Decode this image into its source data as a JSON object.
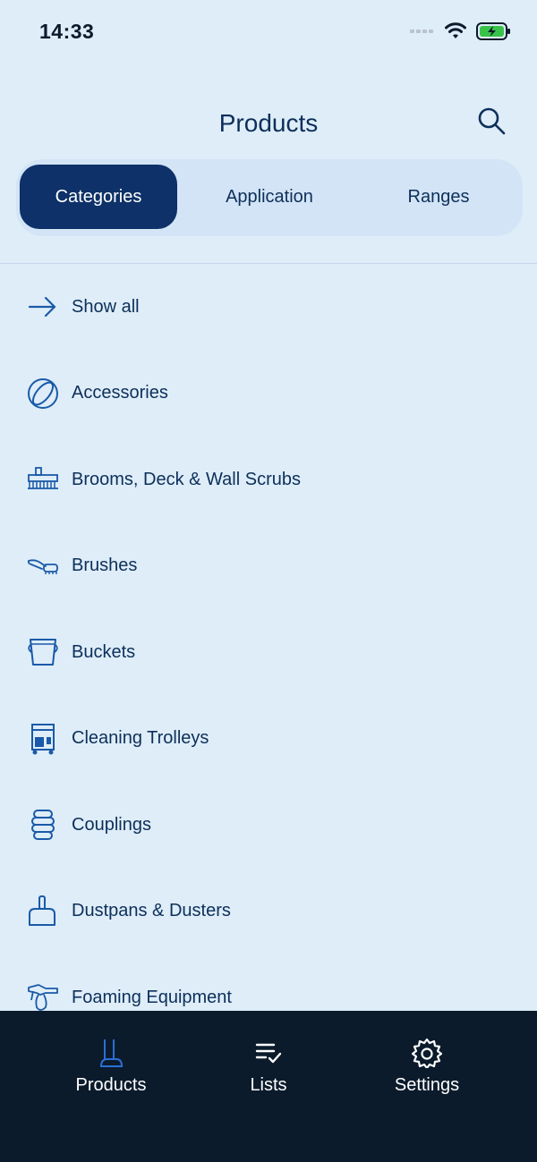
{
  "status": {
    "time": "14:33"
  },
  "header": {
    "title": "Products"
  },
  "segments": [
    {
      "label": "Categories",
      "active": true
    },
    {
      "label": "Application",
      "active": false
    },
    {
      "label": "Ranges",
      "active": false
    }
  ],
  "list": [
    {
      "label": "Show all",
      "icon": "arrow-right-icon"
    },
    {
      "label": "Accessories",
      "icon": "accessories-icon"
    },
    {
      "label": "Brooms, Deck & Wall Scrubs",
      "icon": "broom-icon"
    },
    {
      "label": "Brushes",
      "icon": "brush-icon"
    },
    {
      "label": "Buckets",
      "icon": "bucket-icon"
    },
    {
      "label": "Cleaning Trolleys",
      "icon": "trolley-icon"
    },
    {
      "label": "Couplings",
      "icon": "coupling-icon"
    },
    {
      "label": "Dustpans & Dusters",
      "icon": "dustpan-icon"
    },
    {
      "label": "Foaming Equipment",
      "icon": "foam-gun-icon"
    }
  ],
  "tabbar": [
    {
      "label": "Products",
      "icon": "products-broom-icon"
    },
    {
      "label": "Lists",
      "icon": "list-check-icon"
    },
    {
      "label": "Settings",
      "icon": "gear-icon"
    }
  ],
  "colors": {
    "background": "#deedf8",
    "accent": "#0d3168",
    "icon": "#1a5aa8",
    "tabbar": "#0b1b2c"
  }
}
